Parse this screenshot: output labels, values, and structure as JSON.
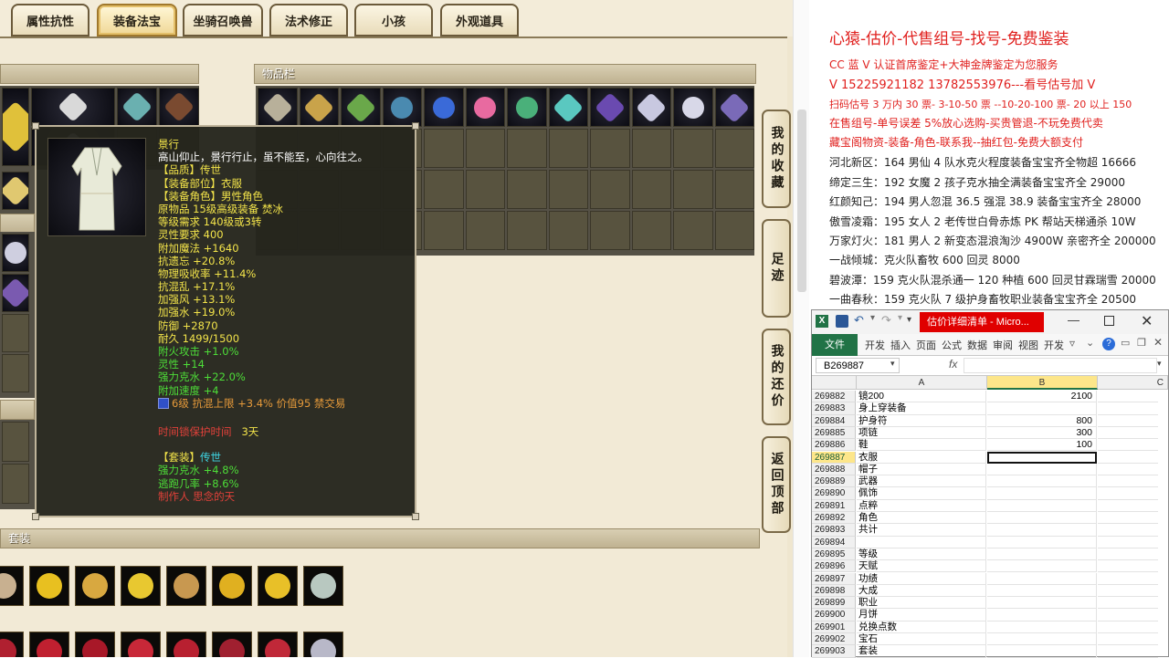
{
  "game": {
    "tabs": [
      "属性抗性",
      "装备法宝",
      "坐骑召唤兽",
      "法术修正",
      "小孩",
      "外观道具"
    ],
    "active_tab": "装备法宝",
    "inventory_title": "物品栏",
    "set_title": "套装",
    "side_buttons": [
      "我的收藏",
      "足迹",
      "我的还价",
      "返回顶部"
    ]
  },
  "tooltip": {
    "name": "景行",
    "desc": "高山仰止，景行行止，虽不能至，心向往之。",
    "quality": "【品质】传世",
    "slot": "【装备部位】衣服",
    "role": "【装备角色】男性角色",
    "origin": "原物品 15级高级装备 焚冰",
    "level_req": "等级需求 140级或3转",
    "spirit_req": "灵性要求 400",
    "stats": [
      "附加魔法 +1640",
      "抗遗忘 +20.8%",
      "物理吸收率 +11.4%",
      "抗混乱 +17.1%",
      "加强风 +13.1%",
      "加强水 +19.0%",
      "防御 +2870",
      "耐久 1499/1500"
    ],
    "extra_stats": [
      "附火攻击 +1.0%",
      "灵性 +14",
      "强力克水 +22.0%",
      "附加速度 +4"
    ],
    "gem_line": "6级 抗混上限 +3.4% 价值95 禁交易",
    "protect_label": "时间锁保护时间",
    "protect_value": "3天",
    "set_label": "【套装】",
    "set_name": "传世",
    "set_stats": [
      "强力克水 +4.8%",
      "逃跑几率 +8.6%"
    ],
    "maker": "制作人 思念的天"
  },
  "notes": {
    "headline": "心猿-估价-代售组号-找号-免费鉴装",
    "lines": [
      "CC 蓝 V 认证首席鉴定+大神金牌鉴定为您服务",
      "V 15225921182       13782553976---看号估号加 V",
      "扫码估号 3 万内 30 票- 3-10-50 票  --10-20-100 票- 20 以上 150",
      "在售组号-单号误差 5%放心选购-买贵管退-不玩免费代卖",
      "藏宝阁物资-装备-角色-联系我--抽红包-免费大额支付",
      "河北新区：164 男仙 4 队水克火程度装备宝宝齐全物超 16666",
      "缔定三生：192 女魔 2 孩子克水抽全满装备宝宝齐全 29000",
      "红颜知己：194 男人忽混 36.5 强混 38.9 装备宝宝齐全 28000",
      "傲雪凌霜：195 女人 2 老传世白骨赤炼 PK 帮站天梯通杀 10W",
      "万家灯火：181 男人 2 新变态混浪淘沙 4900W 亲密齐全 200000",
      "一战倾城：克火队畜牧 600 回灵 8000",
      "碧波潭：159 克火队混杀通一 120 种植 600 回灵甘霖瑞雪 20000",
      "一曲春秋：159 克火队 7 级护身畜牧职业装备宝宝齐全 20500"
    ]
  },
  "excel": {
    "title": "估价详细清单 - Micro...",
    "ribbon_tabs": [
      "文件",
      "开发",
      "插入",
      "页面",
      "公式",
      "数据",
      "审阅",
      "视图",
      "开发"
    ],
    "name_box": "B269887",
    "fx": "fx",
    "col_headers": [
      "A",
      "B",
      "C"
    ],
    "rows": [
      {
        "n": "269882",
        "a": "镜200",
        "b": "2100"
      },
      {
        "n": "269883",
        "a": "身上穿装备",
        "b": ""
      },
      {
        "n": "269884",
        "a": "护身符",
        "b": "800"
      },
      {
        "n": "269885",
        "a": "项链",
        "b": "300"
      },
      {
        "n": "269886",
        "a": "鞋",
        "b": "100"
      },
      {
        "n": "269887",
        "a": "衣服",
        "b": ""
      },
      {
        "n": "269888",
        "a": "帽子",
        "b": ""
      },
      {
        "n": "269889",
        "a": "武器",
        "b": ""
      },
      {
        "n": "269890",
        "a": "佩饰",
        "b": ""
      },
      {
        "n": "269891",
        "a": "点粹",
        "b": ""
      },
      {
        "n": "269892",
        "a": "角色",
        "b": ""
      },
      {
        "n": "269893",
        "a": "共计",
        "b": ""
      },
      {
        "n": "269894",
        "a": "",
        "b": ""
      },
      {
        "n": "269895",
        "a": "等级",
        "b": ""
      },
      {
        "n": "269896",
        "a": "天赋",
        "b": ""
      },
      {
        "n": "269897",
        "a": "功绩",
        "b": ""
      },
      {
        "n": "269898",
        "a": "大成",
        "b": ""
      },
      {
        "n": "269899",
        "a": "职业",
        "b": ""
      },
      {
        "n": "269900",
        "a": "月饼",
        "b": ""
      },
      {
        "n": "269901",
        "a": "兑换点数",
        "b": ""
      },
      {
        "n": "269902",
        "a": "宝石",
        "b": ""
      },
      {
        "n": "269903",
        "a": "套装",
        "b": ""
      }
    ]
  },
  "colors": {
    "stat_green": "#4ddd38",
    "title_yellow": "#f3e44a",
    "notes_red": "#e0201e",
    "excel_green": "#217346",
    "excel_title_red": "#e00000"
  }
}
